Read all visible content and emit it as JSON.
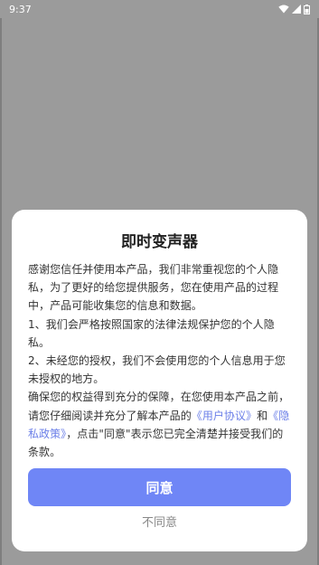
{
  "status_bar": {
    "time": "9:37"
  },
  "dialog": {
    "title": "即时变声器",
    "paragraphs": {
      "intro": "感谢您信任并使用本产品，我们非常重视您的个人隐私，为了更好的给您提供服务，您在使用产品的过程中，产品可能收集您的信息和数据。",
      "point1": "1、我们会严格按照国家的法律法规保护您的个人隐私。",
      "point2": "2、未经您的授权，我们不会使用您的个人信息用于您未授权的地方。"
    },
    "closing": {
      "before": "确保您的权益得到充分的保障，在您使用本产品之前，请您仔细阅读并充分了解本产品的",
      "user_agreement_link": "《用户协议》",
      "and": "和",
      "privacy_policy_link": "《隐私政策》",
      "after": "，点击\"同意\"表示您已完全清楚并接受我们的条款。"
    },
    "agree_label": "同意",
    "disagree_label": "不同意"
  },
  "colors": {
    "overlay": "#9b9b9b",
    "accent": "#6f86f6",
    "link": "#6b7fe8"
  }
}
